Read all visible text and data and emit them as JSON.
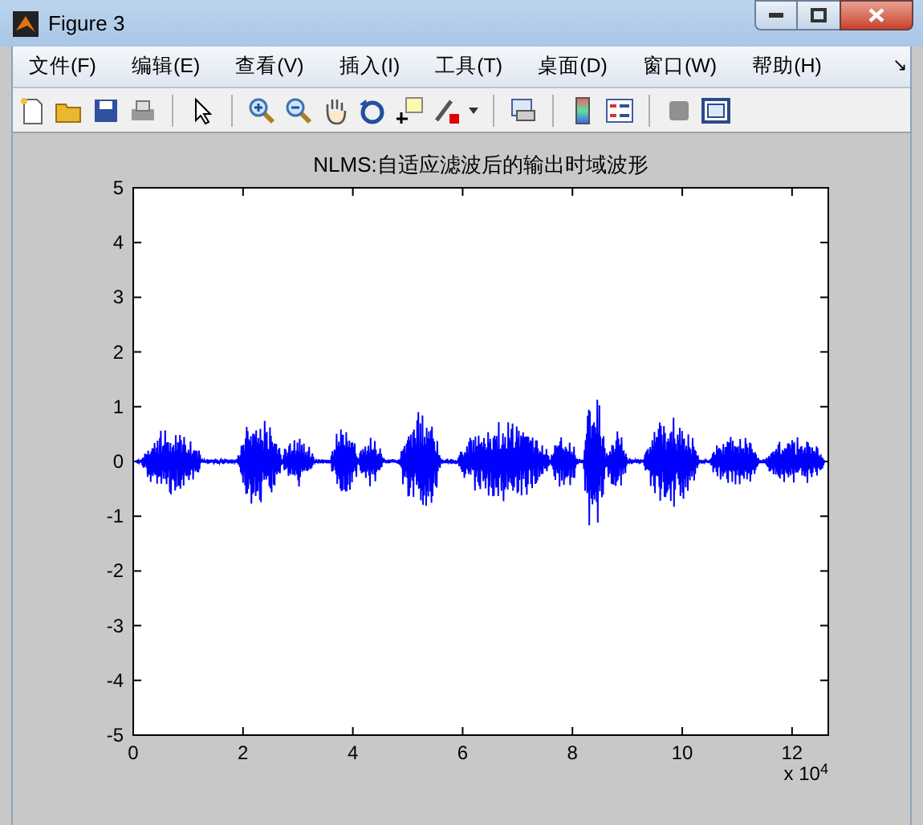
{
  "window": {
    "title": "Figure 3"
  },
  "menu": [
    {
      "label": "文件(F)"
    },
    {
      "label": "编辑(E)"
    },
    {
      "label": "查看(V)"
    },
    {
      "label": "插入(I)"
    },
    {
      "label": "工具(T)"
    },
    {
      "label": "桌面(D)"
    },
    {
      "label": "窗口(W)"
    },
    {
      "label": "帮助(H)"
    }
  ],
  "menu_overflow": "↘",
  "axes": {
    "chart_data": {
      "type": "line",
      "title": "NLMS:自适应滤波后的输出时域波形",
      "xlim": [
        0,
        12.66
      ],
      "ylim": [
        -5,
        5
      ],
      "xticks": [
        0,
        2,
        4,
        6,
        8,
        10,
        12
      ],
      "yticks": [
        -5,
        -4,
        -3,
        -2,
        -1,
        0,
        1,
        2,
        3,
        4,
        5
      ],
      "annotations": [
        "x 10$^{4}$"
      ]
    }
  }
}
